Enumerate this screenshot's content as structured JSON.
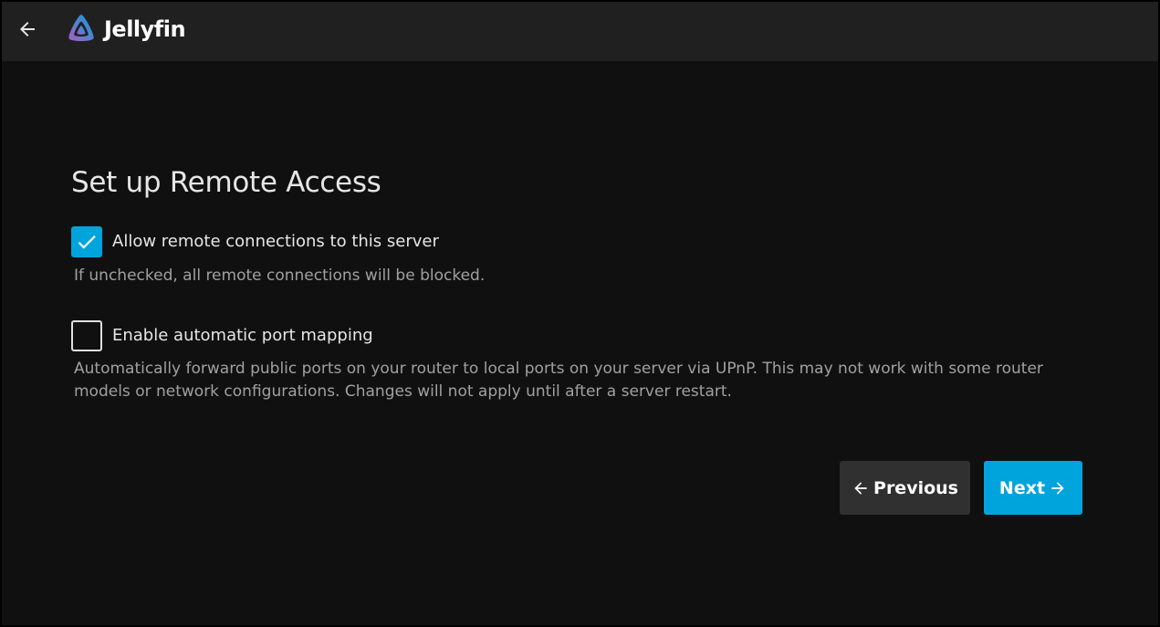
{
  "header": {
    "back_icon": "arrow-left-icon",
    "logo_text": "Jellyfin",
    "logo_icon": "jellyfin-logo-icon",
    "background": "#202020"
  },
  "page": {
    "title": "Set up Remote Access"
  },
  "options": [
    {
      "label": "Allow remote connections to this server",
      "checked": true,
      "help": "If unchecked, all remote connections will be blocked."
    },
    {
      "label": "Enable automatic port mapping",
      "checked": false,
      "help": "Automatically forward public ports on your router to local ports on your server via UPnP. This may not work with some router models or network configurations. Changes will not apply until after a server restart."
    }
  ],
  "buttons": {
    "previous_label": "Previous",
    "previous_icon": "arrow-left-icon",
    "next_label": "Next",
    "next_icon": "arrow-right-icon"
  },
  "colors": {
    "accent": "#00a4dc",
    "background": "#101010",
    "secondary_button": "#303030"
  }
}
